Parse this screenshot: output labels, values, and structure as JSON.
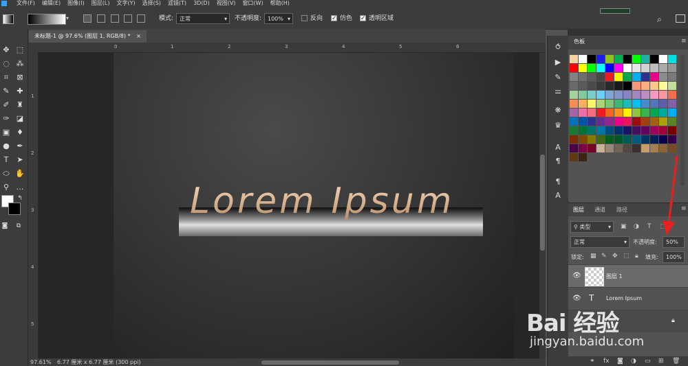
{
  "menu": [
    "文件(F)",
    "编辑(E)",
    "图像(I)",
    "图层(L)",
    "文字(Y)",
    "选择(S)",
    "滤镜(T)",
    "3D(D)",
    "视图(V)",
    "窗口(W)",
    "帮助(H)"
  ],
  "options": {
    "mode_label": "模式:",
    "mode_value": "正常",
    "opacity_label": "不透明度:",
    "opacity_value": "100%",
    "reverse_label": "反向",
    "dither_label": "仿色",
    "transparency_label": "透明区域"
  },
  "document": {
    "tab_title": "未标题-1 @ 97.6% (图层 1, RGB/8) *",
    "canvas_text": "Lorem Ipsum"
  },
  "ruler": {
    "h": [
      "0",
      "1",
      "2",
      "3",
      "4",
      "5",
      "6"
    ],
    "v": [
      "1",
      "2",
      "3",
      "4",
      "5"
    ]
  },
  "status": {
    "zoom": "97.61%",
    "doc_size": "6.77 厘米 x 6.77 厘米 (300 ppi)"
  },
  "swatches_panel": {
    "title": "色板",
    "colors": [
      [
        "#f5d3a7",
        "#ffffff",
        "#000000",
        "#1e1ee8",
        "#8dc21f",
        "#00b050",
        "#000000",
        "#00ff00",
        "#20b0a0",
        "#000000",
        "#ffffff",
        "#00e0e0"
      ],
      [
        "#ff0000",
        "#ffff00",
        "#00ff00",
        "#00ffff",
        "#0000ff",
        "#ff00ff",
        "#ffffff",
        "#e6e6e6",
        "#d2d2d2",
        "#bebebe",
        "#aaaaaa",
        "#969696"
      ],
      [
        "#828282",
        "#6e6e6e",
        "#5a5a5a",
        "#464646",
        "#ed1c24",
        "#fff200",
        "#00a651",
        "#00aeef",
        "#2e3192",
        "#ec008c",
        "#8c8c8c",
        "#7a7a7a"
      ],
      [
        "#6a6a6a",
        "#5a5a5a",
        "#4a4a4a",
        "#3a3a3a",
        "#2a2a2a",
        "#1a1a1a",
        "#000000",
        "#f7977a",
        "#f9ad81",
        "#fdc68a",
        "#fff79a",
        "#c4df9b"
      ],
      [
        "#a3d39c",
        "#82ca9d",
        "#7bcdc8",
        "#6ecff6",
        "#7ea7d8",
        "#8493ca",
        "#8882be",
        "#a187be",
        "#bc8dbf",
        "#f49ac2",
        "#f6989d",
        "#f26c4f"
      ],
      [
        "#f68e56",
        "#fbaf5d",
        "#fff568",
        "#acd373",
        "#7cc576",
        "#3bb878",
        "#1abbb4",
        "#00bff3",
        "#438ccb",
        "#5574b9",
        "#605ca8",
        "#855fa8"
      ],
      [
        "#a763a8",
        "#f06ea9",
        "#f26d7d",
        "#ed1c24",
        "#f26522",
        "#f7941d",
        "#fff200",
        "#8dc63f",
        "#39b54a",
        "#00a651",
        "#00a99d",
        "#00aeef"
      ],
      [
        "#0072bc",
        "#0054a6",
        "#2e3192",
        "#662d91",
        "#92278f",
        "#ec008c",
        "#ed145b",
        "#9e0b0f",
        "#a0410d",
        "#a3620a",
        "#aba000",
        "#598527"
      ],
      [
        "#197b30",
        "#007236",
        "#00746b",
        "#0076a3",
        "#004b80",
        "#003471",
        "#1b1464",
        "#440e62",
        "#630460",
        "#9e005d",
        "#9e0039",
        "#790000"
      ],
      [
        "#7b2e00",
        "#7d4900",
        "#827b00",
        "#406618",
        "#005e20",
        "#005826",
        "#005952",
        "#005b7f",
        "#003663",
        "#002157",
        "#0d004c",
        "#32004b"
      ],
      [
        "#4b0049",
        "#7b0046",
        "#7a0026",
        "#c7b299",
        "#998675",
        "#736357",
        "#534741",
        "#37302d",
        "#c69c6d",
        "#a67c52",
        "#8c6239",
        "#754c24"
      ],
      [
        "#603913",
        "#3c2415"
      ]
    ]
  },
  "layers_panel": {
    "tabs": [
      "图层",
      "通道",
      "路径"
    ],
    "filter_kind": "类型",
    "blend_mode": "正常",
    "opacity_label": "不透明度:",
    "opacity_value": "50%",
    "lock_label": "锁定:",
    "fill_label": "填充:",
    "fill_value": "100%",
    "layers": [
      {
        "name": "图层 1"
      },
      {
        "name": "Lorem Ipsum"
      }
    ]
  },
  "watermark": {
    "logo": "Bai 经验",
    "url": "jingyan.baidu.com"
  }
}
